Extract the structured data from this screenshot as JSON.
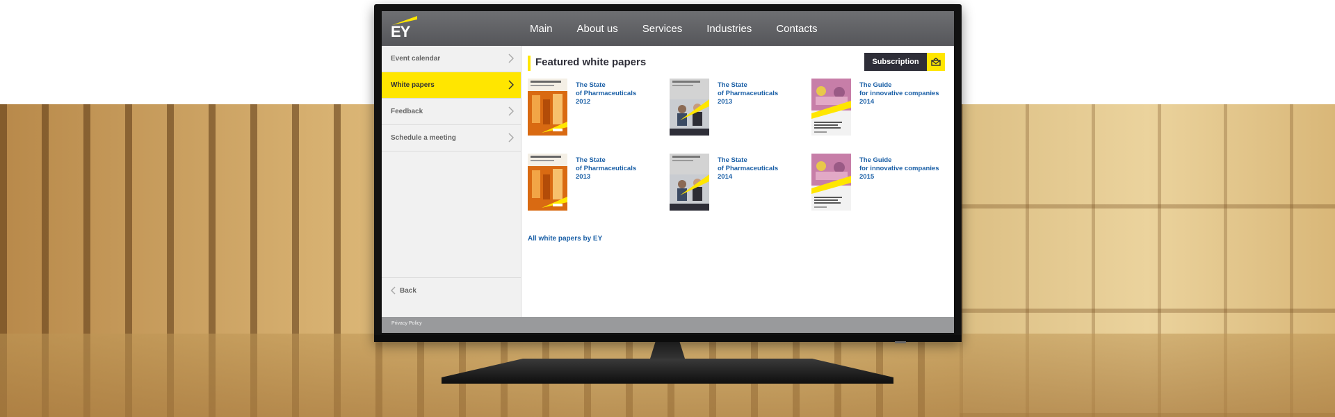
{
  "header": {
    "logo_text": "EY",
    "nav": [
      {
        "label": "Main"
      },
      {
        "label": "About us"
      },
      {
        "label": "Services"
      },
      {
        "label": "Industries"
      },
      {
        "label": "Contacts"
      }
    ]
  },
  "sidebar": {
    "items": [
      {
        "label": "Event calendar",
        "active": false
      },
      {
        "label": "White papers",
        "active": true
      },
      {
        "label": "Feedback",
        "active": false
      },
      {
        "label": "Schedule a meeting",
        "active": false
      }
    ],
    "back_label": "Back"
  },
  "footer": {
    "privacy_label": "Privacy Policy"
  },
  "main": {
    "title": "Featured white papers",
    "subscribe_label": "Subscription",
    "papers": [
      {
        "lines": [
          "The State",
          "of Pharmaceuticals",
          "2012"
        ],
        "thumb": "pharma-orange"
      },
      {
        "lines": [
          "The State",
          "of Pharmaceuticals",
          "2013"
        ],
        "thumb": "pharma-office"
      },
      {
        "lines": [
          "The Guide",
          "for innovative companies",
          "2014"
        ],
        "thumb": "guide-pink"
      },
      {
        "lines": [
          "The State",
          "of Pharmaceuticals",
          "2013"
        ],
        "thumb": "pharma-orange"
      },
      {
        "lines": [
          "The State",
          "of Pharmaceuticals",
          "2014"
        ],
        "thumb": "pharma-office"
      },
      {
        "lines": [
          "The Guide",
          "for innovative companies",
          "2015"
        ],
        "thumb": "guide-pink"
      }
    ],
    "all_link": "All white papers by EY"
  },
  "colors": {
    "brand_yellow": "#ffe600",
    "dark": "#2e2e38",
    "link_blue": "#1a5fa6"
  }
}
